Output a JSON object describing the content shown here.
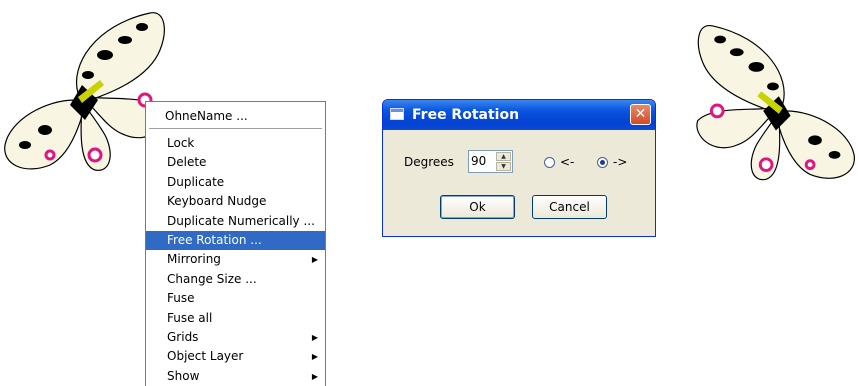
{
  "context_menu": {
    "header": "OhneName ...",
    "items": [
      {
        "label": "Lock",
        "submenu": false,
        "highlighted": false
      },
      {
        "label": "Delete",
        "submenu": false,
        "highlighted": false
      },
      {
        "label": "Duplicate",
        "submenu": false,
        "highlighted": false
      },
      {
        "label": "Keyboard Nudge",
        "submenu": false,
        "highlighted": false
      },
      {
        "label": "Duplicate Numerically ...",
        "submenu": false,
        "highlighted": false
      },
      {
        "label": "Free Rotation ...",
        "submenu": false,
        "highlighted": true
      },
      {
        "label": "Mirroring",
        "submenu": true,
        "highlighted": false
      },
      {
        "label": "Change Size ...",
        "submenu": false,
        "highlighted": false
      },
      {
        "label": "Fuse",
        "submenu": false,
        "highlighted": false
      },
      {
        "label": "Fuse all",
        "submenu": false,
        "highlighted": false
      },
      {
        "label": "Grids",
        "submenu": true,
        "highlighted": false
      },
      {
        "label": "Object Layer",
        "submenu": true,
        "highlighted": false
      },
      {
        "label": "Show",
        "submenu": true,
        "highlighted": false
      }
    ]
  },
  "dialog": {
    "title": "Free Rotation",
    "close_glyph": "✕",
    "degrees_label": "Degrees",
    "degrees_value": "90",
    "radio_left_label": "<-",
    "radio_right_label": "->",
    "selected_direction": "right",
    "ok_label": "Ok",
    "cancel_label": "Cancel"
  },
  "icons": {
    "butterfly_left": "butterfly-icon",
    "butterfly_right": "butterfly-icon",
    "window_icon": "window-icon",
    "submenu_arrow": "▶"
  },
  "colors": {
    "highlight": "#316ac5",
    "titlebar": "#0a55e0",
    "dialog_bg": "#ece9d8",
    "close_button": "#d24a25"
  }
}
